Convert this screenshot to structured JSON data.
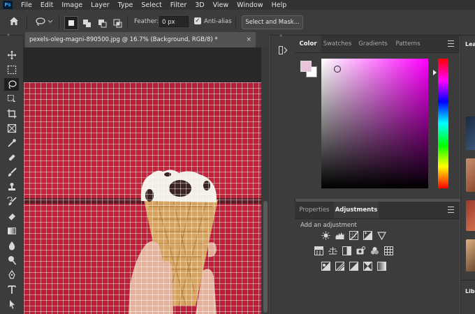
{
  "menu": {
    "items": [
      "File",
      "Edit",
      "Image",
      "Layer",
      "Type",
      "Select",
      "Filter",
      "3D",
      "View",
      "Window",
      "Help"
    ]
  },
  "options": {
    "feather_label": "Feather:",
    "feather_value": "0 px",
    "antialias_label": "Anti-alias",
    "antialias_checked": true,
    "select_mask_label": "Select and Mask..."
  },
  "document": {
    "tab_title": "pexels-oleg-magni-890500.jpg @ 16.7% (Background, RGB/8) *",
    "close_glyph": "×"
  },
  "color_panel": {
    "tabs": [
      "Color",
      "Swatches",
      "Gradients",
      "Patterns"
    ],
    "active_tab": "Color",
    "foreground_color": "#e7c3dc",
    "background_color": "#ffffff",
    "hue_color": "#ff00ff"
  },
  "adjustments_panel": {
    "tabs": [
      "Properties",
      "Adjustments"
    ],
    "active_tab": "Adjustments",
    "heading": "Add an adjustment"
  },
  "far_panel": {
    "tab_label": "Lea",
    "bottom_label": "Libr"
  },
  "colors": {
    "background_red": "#c3223a",
    "accent_blue": "#31a8ff"
  }
}
